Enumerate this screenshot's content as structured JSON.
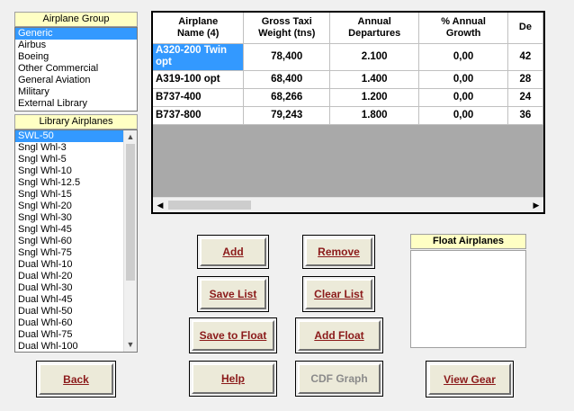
{
  "airplane_group": {
    "title": "Airplane Group",
    "items": [
      "Generic",
      "Airbus",
      "Boeing",
      "Other Commercial",
      "General Aviation",
      "Military",
      "External Library"
    ],
    "selected_index": 0
  },
  "library_airplanes": {
    "title": "Library Airplanes",
    "items": [
      "SWL-50",
      "Sngl Whl-3",
      "Sngl Whl-5",
      "Sngl Whl-10",
      "Sngl Whl-12.5",
      "Sngl Whl-15",
      "Sngl Whl-20",
      "Sngl Whl-30",
      "Sngl Whl-45",
      "Sngl Whl-60",
      "Sngl Whl-75",
      "Dual Whl-10",
      "Dual Whl-20",
      "Dual Whl-30",
      "Dual Whl-45",
      "Dual Whl-50",
      "Dual Whl-60",
      "Dual Whl-75",
      "Dual Whl-100"
    ],
    "selected_index": 0
  },
  "grid": {
    "headers": [
      "Airplane\nName (4)",
      "Gross Taxi\nWeight (tns)",
      "Annual\nDepartures",
      "% Annual\nGrowth",
      "De"
    ],
    "rows": [
      [
        "A320-200 Twin opt",
        "78,400",
        "2.100",
        "0,00",
        "42"
      ],
      [
        "A319-100 opt",
        "68,400",
        "1.400",
        "0,00",
        "28"
      ],
      [
        "B737-400",
        "68,266",
        "1.200",
        "0,00",
        "24"
      ],
      [
        "B737-800",
        "79,243",
        "1.800",
        "0,00",
        "36"
      ]
    ],
    "selected_row": 0
  },
  "float_airplanes": {
    "title": "Float Airplanes",
    "items": []
  },
  "buttons": {
    "add": "Add",
    "remove": "Remove",
    "save_list": "Save List",
    "clear_list": "Clear List",
    "save_to_float": "Save to Float",
    "add_float": "Add Float",
    "back": "Back",
    "help": "Help",
    "cdf_graph": "CDF Graph",
    "view_gear": "View Gear"
  },
  "colors": {
    "selection": "#3399ff",
    "header_bg": "#ffffc4",
    "button_text": "#8b1a1a",
    "disabled_text": "#8a8a8a"
  }
}
